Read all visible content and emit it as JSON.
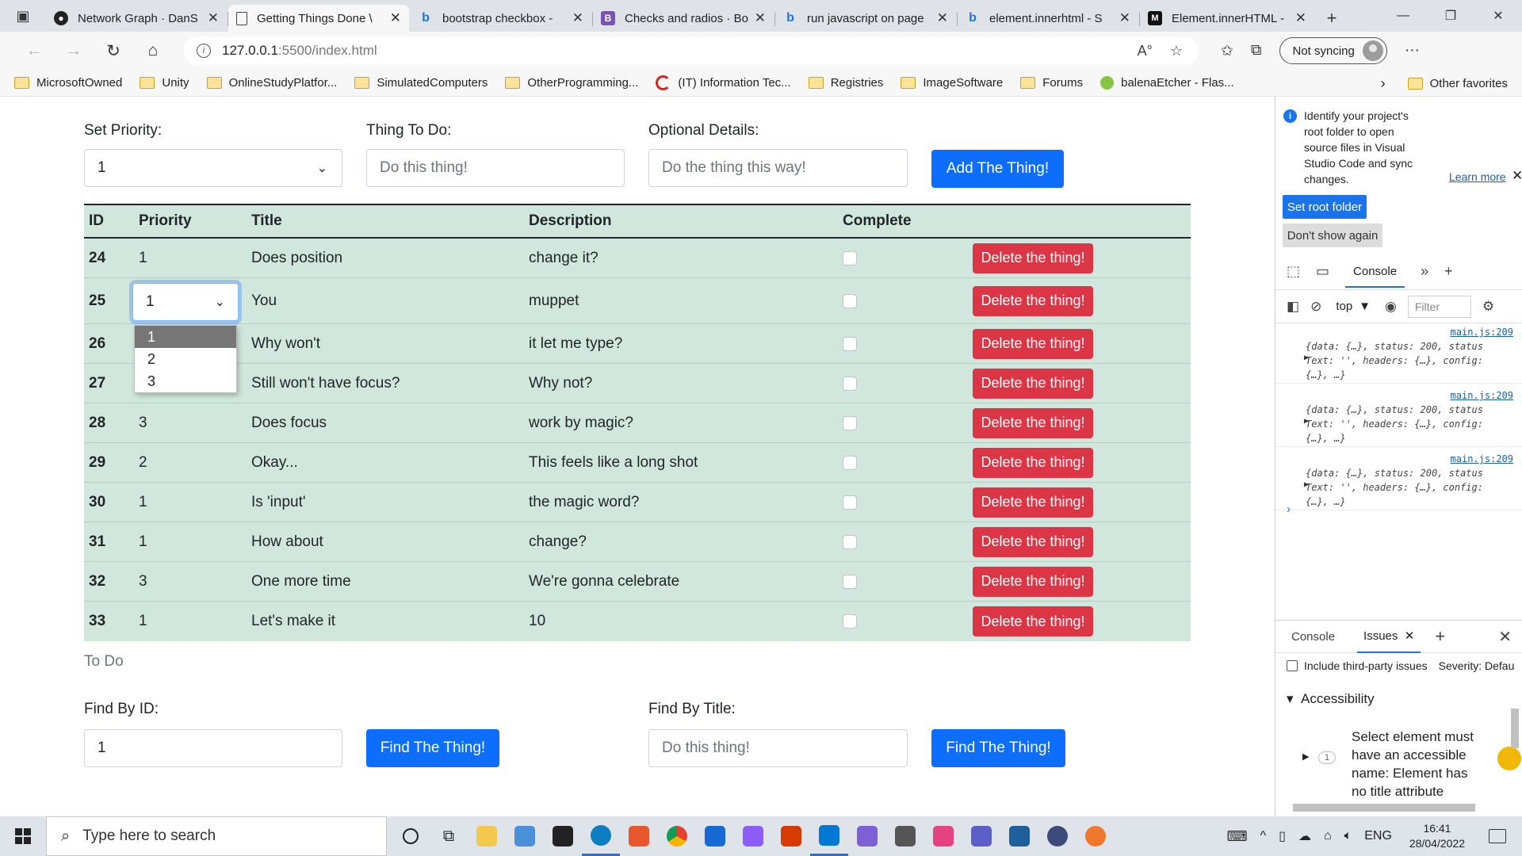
{
  "browser": {
    "tabs": [
      {
        "label": "Network Graph · DanS",
        "icon": "github-icon",
        "active": false
      },
      {
        "label": "Getting Things Done \\",
        "icon": "page-icon",
        "active": true
      },
      {
        "label": "bootstrap checkbox -",
        "icon": "bing-icon",
        "active": false
      },
      {
        "label": "Checks and radios · Bo",
        "icon": "bootstrap-icon",
        "active": false
      },
      {
        "label": "run javascript on page",
        "icon": "bing-icon",
        "active": false
      },
      {
        "label": "element.innerhtml - S",
        "icon": "bing-icon",
        "active": false
      },
      {
        "label": "Element.innerHTML -",
        "icon": "mdn-icon",
        "active": false
      }
    ],
    "url_host": "127.0.0.1",
    "url_rest": ":5500/index.html",
    "sync_label": "Not syncing",
    "favorites": [
      {
        "label": "MicrosoftOwned",
        "icon": "folder-icon"
      },
      {
        "label": "Unity",
        "icon": "folder-icon"
      },
      {
        "label": "OnlineStudyPlatfor...",
        "icon": "folder-icon"
      },
      {
        "label": "SimulatedComputers",
        "icon": "folder-icon"
      },
      {
        "label": "OtherProgramming...",
        "icon": "folder-icon"
      },
      {
        "label": "(IT) Information Tec...",
        "icon": "site-c-icon"
      },
      {
        "label": "Registries",
        "icon": "folder-icon"
      },
      {
        "label": "ImageSoftware",
        "icon": "folder-icon"
      },
      {
        "label": "Forums",
        "icon": "folder-icon"
      },
      {
        "label": "balenaEtcher - Flas...",
        "icon": "balena-icon"
      }
    ],
    "other_favorites": "Other favorites"
  },
  "form": {
    "priority_label": "Set Priority:",
    "priority_value": "1",
    "thing_label": "Thing To Do:",
    "thing_placeholder": "Do this thing!",
    "details_label": "Optional Details:",
    "details_placeholder": "Do the thing this way!",
    "add_button": "Add The Thing!"
  },
  "table": {
    "headers": {
      "id": "ID",
      "priority": "Priority",
      "title": "Title",
      "description": "Description",
      "complete": "Complete"
    },
    "delete_label": "Delete the thing!",
    "rows": [
      {
        "id": "24",
        "priority": "1",
        "title": "Does position",
        "description": "change it?"
      },
      {
        "id": "25",
        "priority": "1",
        "title": "You",
        "description": "muppet"
      },
      {
        "id": "26",
        "priority": "",
        "title": "Why won't",
        "description": "it let me type?"
      },
      {
        "id": "27",
        "priority": "",
        "title": "Still won't have focus?",
        "description": "Why not?"
      },
      {
        "id": "28",
        "priority": "3",
        "title": "Does focus",
        "description": "work by magic?"
      },
      {
        "id": "29",
        "priority": "2",
        "title": "Okay...",
        "description": "This feels like a long shot"
      },
      {
        "id": "30",
        "priority": "1",
        "title": "Is 'input'",
        "description": "the magic word?"
      },
      {
        "id": "31",
        "priority": "1",
        "title": "How about",
        "description": "change?"
      },
      {
        "id": "32",
        "priority": "3",
        "title": "One more time",
        "description": "We're gonna celebrate"
      },
      {
        "id": "33",
        "priority": "1",
        "title": "Let's make it",
        "description": "10"
      }
    ],
    "inline_select_value": "1",
    "dropdown_options": [
      "1",
      "2",
      "3"
    ],
    "caption": "To Do"
  },
  "find": {
    "id_label": "Find By ID:",
    "id_value": "1",
    "id_button": "Find The Thing!",
    "title_label": "Find By Title:",
    "title_placeholder": "Do this thing!",
    "title_button": "Find The Thing!"
  },
  "devtools": {
    "info_text": "Identify your project's root folder to open source files in Visual Studio Code and sync changes.",
    "learn_more": "Learn more",
    "set_root": "Set root folder",
    "dont_show": "Don't show again",
    "console_tab": "Console",
    "context": "top",
    "filter_placeholder": "Filter",
    "logs": [
      {
        "src": "main.js:209",
        "text": "{data: {…}, status: 200, statusText: '', headers: {…}, config: {…}, …}"
      },
      {
        "src": "main.js:209",
        "text": "{data: {…}, status: 200, statusText: '', headers: {…}, config: {…}, …}"
      },
      {
        "src": "main.js:209",
        "text": "{data: {…}, status: 200, statusText: '', headers: {…}, config: {…}, …}"
      }
    ],
    "drawer_console": "Console",
    "drawer_issues": "Issues",
    "third_party": "Include third-party issues",
    "severity": "Severity: Defau",
    "accessibility": "Accessibility",
    "issue_count": "1",
    "issue_text": "Select element must have an accessible name: Element has no title attribute"
  },
  "taskbar": {
    "search_placeholder": "Type here to search",
    "lang": "ENG",
    "time": "16:41",
    "date": "28/04/2022",
    "app_colors": [
      "#f2c94c",
      "#4a90d9",
      "#222222",
      "#0f7dc2",
      "#e8582c",
      "#e34133",
      "#1769d3",
      "#8b5cf6",
      "#d83b01",
      "#0078d4",
      "#7d5fd6",
      "#555555",
      "#e5437f",
      "#5b5fc7",
      "#1f5f9e",
      "#3c4b7a",
      "#f0782c"
    ]
  }
}
